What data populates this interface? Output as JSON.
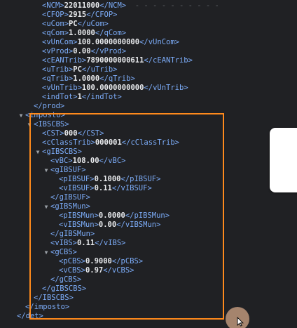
{
  "xml_lines": [
    {
      "indent": 4,
      "toggle": false,
      "kind": "elem",
      "tag": "NCM",
      "value": "22011000",
      "trail": "- - - - - - - - - -"
    },
    {
      "indent": 4,
      "toggle": false,
      "kind": "elem",
      "tag": "CFOP",
      "value": "2915"
    },
    {
      "indent": 4,
      "toggle": false,
      "kind": "elem",
      "tag": "uCom",
      "value": "PC"
    },
    {
      "indent": 4,
      "toggle": false,
      "kind": "elem",
      "tag": "qCom",
      "value": "1.0000"
    },
    {
      "indent": 4,
      "toggle": false,
      "kind": "elem",
      "tag": "vUnCom",
      "value": "100.0000000000"
    },
    {
      "indent": 4,
      "toggle": false,
      "kind": "elem",
      "tag": "vProd",
      "value": "0.00"
    },
    {
      "indent": 4,
      "toggle": false,
      "kind": "elem",
      "tag": "cEANTrib",
      "value": "7890000000611"
    },
    {
      "indent": 4,
      "toggle": false,
      "kind": "elem",
      "tag": "uTrib",
      "value": "PC"
    },
    {
      "indent": 4,
      "toggle": false,
      "kind": "elem",
      "tag": "qTrib",
      "value": "1.0000"
    },
    {
      "indent": 4,
      "toggle": false,
      "kind": "elem",
      "tag": "vUnTrib",
      "value": "100.0000000000"
    },
    {
      "indent": 4,
      "toggle": false,
      "kind": "elem",
      "tag": "indTot",
      "value": "1"
    },
    {
      "indent": 3,
      "toggle": false,
      "kind": "close",
      "tag": "prod"
    },
    {
      "indent": 2,
      "toggle": true,
      "kind": "open",
      "tag": "imposto"
    },
    {
      "indent": 3,
      "toggle": true,
      "kind": "open",
      "tag": "IBSCBS"
    },
    {
      "indent": 4,
      "toggle": false,
      "kind": "elem",
      "tag": "CST",
      "value": "000"
    },
    {
      "indent": 4,
      "toggle": false,
      "kind": "elem",
      "tag": "cClassTrib",
      "value": "000001"
    },
    {
      "indent": 4,
      "toggle": true,
      "kind": "open",
      "tag": "gIBSCBS"
    },
    {
      "indent": 5,
      "toggle": false,
      "kind": "elem",
      "tag": "vBC",
      "value": "108.00"
    },
    {
      "indent": 5,
      "toggle": true,
      "kind": "open",
      "tag": "gIBSUF"
    },
    {
      "indent": 6,
      "toggle": false,
      "kind": "elem",
      "tag": "pIBSUF",
      "value": "0.1000"
    },
    {
      "indent": 6,
      "toggle": false,
      "kind": "elem",
      "tag": "vIBSUF",
      "value": "0.11"
    },
    {
      "indent": 5,
      "toggle": false,
      "kind": "close",
      "tag": "gIBSUF"
    },
    {
      "indent": 5,
      "toggle": true,
      "kind": "open",
      "tag": "gIBSMun"
    },
    {
      "indent": 6,
      "toggle": false,
      "kind": "elem",
      "tag": "pIBSMun",
      "value": "0.0000"
    },
    {
      "indent": 6,
      "toggle": false,
      "kind": "elem",
      "tag": "vIBSMun",
      "value": "0.00"
    },
    {
      "indent": 5,
      "toggle": false,
      "kind": "close",
      "tag": "gIBSMun"
    },
    {
      "indent": 5,
      "toggle": false,
      "kind": "elem",
      "tag": "vIBS",
      "value": "0.11"
    },
    {
      "indent": 5,
      "toggle": true,
      "kind": "open",
      "tag": "gCBS"
    },
    {
      "indent": 6,
      "toggle": false,
      "kind": "elem",
      "tag": "pCBS",
      "value": "0.9000"
    },
    {
      "indent": 6,
      "toggle": false,
      "kind": "elem",
      "tag": "vCBS",
      "value": "0.97"
    },
    {
      "indent": 5,
      "toggle": false,
      "kind": "close",
      "tag": "gCBS"
    },
    {
      "indent": 4,
      "toggle": false,
      "kind": "close",
      "tag": "gIBSCBS"
    },
    {
      "indent": 3,
      "toggle": false,
      "kind": "close",
      "tag": "IBSCBS"
    },
    {
      "indent": 2,
      "toggle": false,
      "kind": "close",
      "tag": "imposto"
    },
    {
      "indent": 1,
      "toggle": false,
      "kind": "close",
      "tag": "det"
    }
  ],
  "toggle_glyph": "▼",
  "colors": {
    "background": "#202124",
    "tag": "#7cacf8",
    "value": "#e8eaed",
    "highlight": "#ff8a1c",
    "cursor": "#ad8a72"
  },
  "icons": {
    "toggle": "expand-triangle-icon",
    "cursor": "mouse-pointer-icon"
  }
}
